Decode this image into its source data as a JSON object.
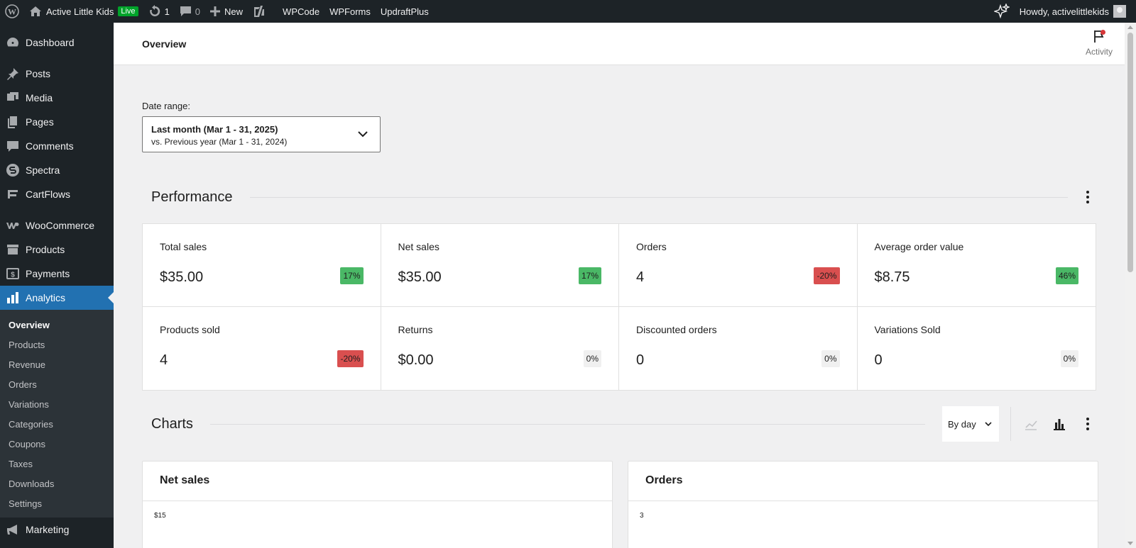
{
  "admin_bar": {
    "site_name": "Active Little Kids",
    "live_badge": "Live",
    "updates_count": "1",
    "comments_count": "0",
    "new_label": "New",
    "links": [
      "WPCode",
      "WPForms",
      "UpdraftPlus"
    ],
    "greeting": "Howdy, activelittlekids"
  },
  "sidebar": {
    "items": [
      {
        "label": "Dashboard",
        "icon": "dashboard-icon"
      },
      {
        "label": "Posts",
        "icon": "pin-icon"
      },
      {
        "label": "Media",
        "icon": "media-icon"
      },
      {
        "label": "Pages",
        "icon": "pages-icon"
      },
      {
        "label": "Comments",
        "icon": "comment-icon"
      },
      {
        "label": "Spectra",
        "icon": "spectra-icon"
      },
      {
        "label": "CartFlows",
        "icon": "cartflows-icon"
      },
      {
        "label": "WooCommerce",
        "icon": "woo-icon"
      },
      {
        "label": "Products",
        "icon": "archive-icon"
      },
      {
        "label": "Payments",
        "icon": "payments-icon"
      },
      {
        "label": "Analytics",
        "icon": "bar-chart-icon"
      }
    ],
    "submenu": [
      "Overview",
      "Products",
      "Revenue",
      "Orders",
      "Variations",
      "Categories",
      "Coupons",
      "Taxes",
      "Downloads",
      "Settings"
    ],
    "after_submenu": {
      "label": "Marketing",
      "icon": "megaphone-icon"
    }
  },
  "header": {
    "title": "Overview",
    "activity_label": "Activity"
  },
  "date_range": {
    "label": "Date range:",
    "primary": "Last month (Mar 1 - 31, 2025)",
    "secondary": "vs. Previous year (Mar 1 - 31, 2024)"
  },
  "performance": {
    "title": "Performance",
    "cards": [
      {
        "label": "Total sales",
        "value": "$35.00",
        "delta": "17%",
        "trend": "up"
      },
      {
        "label": "Net sales",
        "value": "$35.00",
        "delta": "17%",
        "trend": "up"
      },
      {
        "label": "Orders",
        "value": "4",
        "delta": "-20%",
        "trend": "down"
      },
      {
        "label": "Average order value",
        "value": "$8.75",
        "delta": "46%",
        "trend": "up"
      },
      {
        "label": "Products sold",
        "value": "4",
        "delta": "-20%",
        "trend": "down"
      },
      {
        "label": "Returns",
        "value": "$0.00",
        "delta": "0%",
        "trend": "flat"
      },
      {
        "label": "Discounted orders",
        "value": "0",
        "delta": "0%",
        "trend": "flat"
      },
      {
        "label": "Variations Sold",
        "value": "0",
        "delta": "0%",
        "trend": "flat"
      }
    ]
  },
  "charts": {
    "title": "Charts",
    "interval": "By day",
    "cards": [
      {
        "title": "Net sales",
        "top_tick": "$15"
      },
      {
        "title": "Orders",
        "top_tick": "3"
      }
    ]
  },
  "colors": {
    "admin_bg": "#1d2327",
    "active_menu": "#2271b1",
    "delta_up": "#4ab866",
    "delta_down": "#d94f4f",
    "live": "#00a32a"
  }
}
